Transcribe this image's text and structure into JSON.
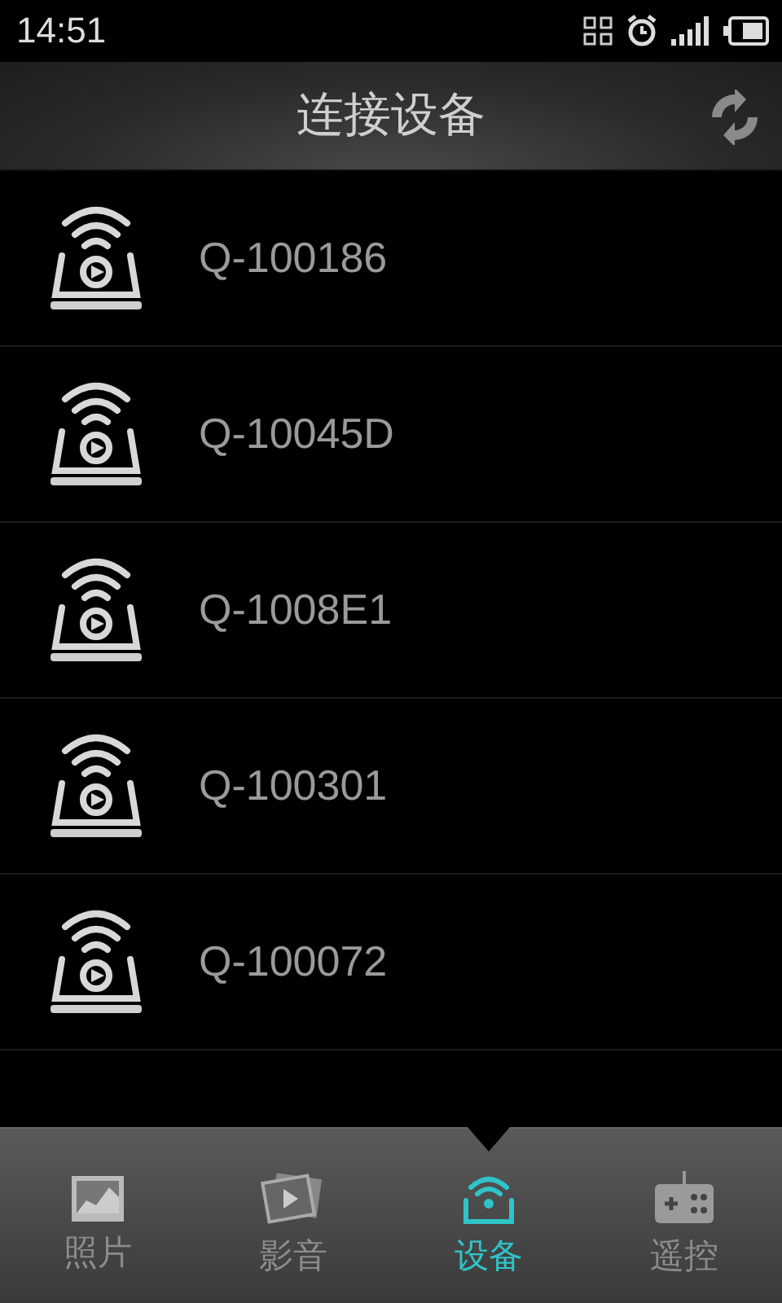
{
  "status_bar": {
    "time": "14:51"
  },
  "header": {
    "title": "连接设备"
  },
  "devices": [
    {
      "name": "Q-100186"
    },
    {
      "name": "Q-10045D"
    },
    {
      "name": "Q-1008E1"
    },
    {
      "name": "Q-100301"
    },
    {
      "name": "Q-100072"
    }
  ],
  "tabs": [
    {
      "kind": "photo",
      "label": "照片",
      "selected": false
    },
    {
      "kind": "video",
      "label": "影音",
      "selected": false
    },
    {
      "kind": "device",
      "label": "设备",
      "selected": true
    },
    {
      "kind": "remote",
      "label": "遥控",
      "selected": false
    }
  ]
}
